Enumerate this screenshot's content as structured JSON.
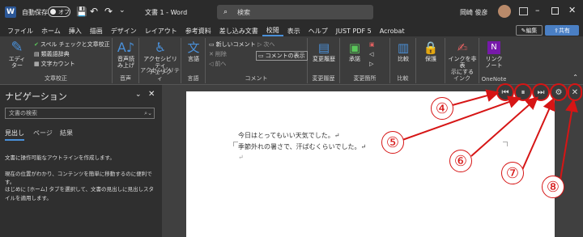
{
  "titlebar": {
    "autosave_label": "自動保存",
    "autosave_state": "オフ",
    "doc_title": "文書 1 - Word",
    "search_placeholder": "検索",
    "user_name": "岡崎 俊彦"
  },
  "menu": [
    "ファイル",
    "ホーム",
    "挿入",
    "描画",
    "デザイン",
    "レイアウト",
    "参考資料",
    "差し込み文書",
    "校閲",
    "表示",
    "ヘルプ",
    "JUST PDF 5",
    "Acrobat"
  ],
  "menu_right": {
    "edit": "編集",
    "share": "共有"
  },
  "ribbon": {
    "proof": {
      "editor": "エディ\nター",
      "spell": "スペル チェックと文章校正",
      "thesaurus": "類義語辞典",
      "wordcount": "文字カウント",
      "group": "文章校正"
    },
    "speech": {
      "read": "音声読\nみ上げ",
      "group": "音声"
    },
    "access": {
      "check": "アクセシビリティ\nチェック",
      "group": "アクセシビリティ"
    },
    "lang": {
      "lang": "言語",
      "group": "言語"
    },
    "comment": {
      "new": "新しいコメント",
      "delete": "削除",
      "prev": "前へ",
      "next": "次へ",
      "show": "コメントの表示",
      "group": "コメント"
    },
    "track": {
      "track": "変更履歴",
      "group": "変更履歴"
    },
    "changes": {
      "accept": "承諾",
      "group": "変更箇所"
    },
    "compare": {
      "compare": "比較",
      "group": "比較"
    },
    "protect": {
      "protect": "保護",
      "group": ""
    },
    "ink": {
      "hide": "インクを非表\n示にする",
      "group": "インク"
    },
    "onenote": {
      "link": "リンク\nノート",
      "group": "OneNote"
    }
  },
  "nav": {
    "title": "ナビゲーション",
    "search_placeholder": "文書の検索",
    "tabs": [
      "見出し",
      "ページ",
      "結果"
    ],
    "text1": "文書に操作可能なアウトラインを作成します。",
    "text2": "現在の位置がわかり、コンテンツを簡単に移動するのに便利です。",
    "text3": "はじめに [ホーム] タブを選択して、文書の見出しに見出しスタイルを適用します。"
  },
  "doc": {
    "line1": "今日はとってもいい天気でした。↵",
    "line2": "季節外れの暑さで、汗ばむくらいでした。↵",
    "line3": "↵"
  },
  "playback": {
    "rewind_icon": "⏮",
    "pause_icon": "⏸",
    "forward_icon": "⏭",
    "settings_icon": "⚙",
    "close_icon": "✕"
  },
  "callouts": [
    "④",
    "⑤",
    "⑥",
    "⑦",
    "⑧"
  ]
}
